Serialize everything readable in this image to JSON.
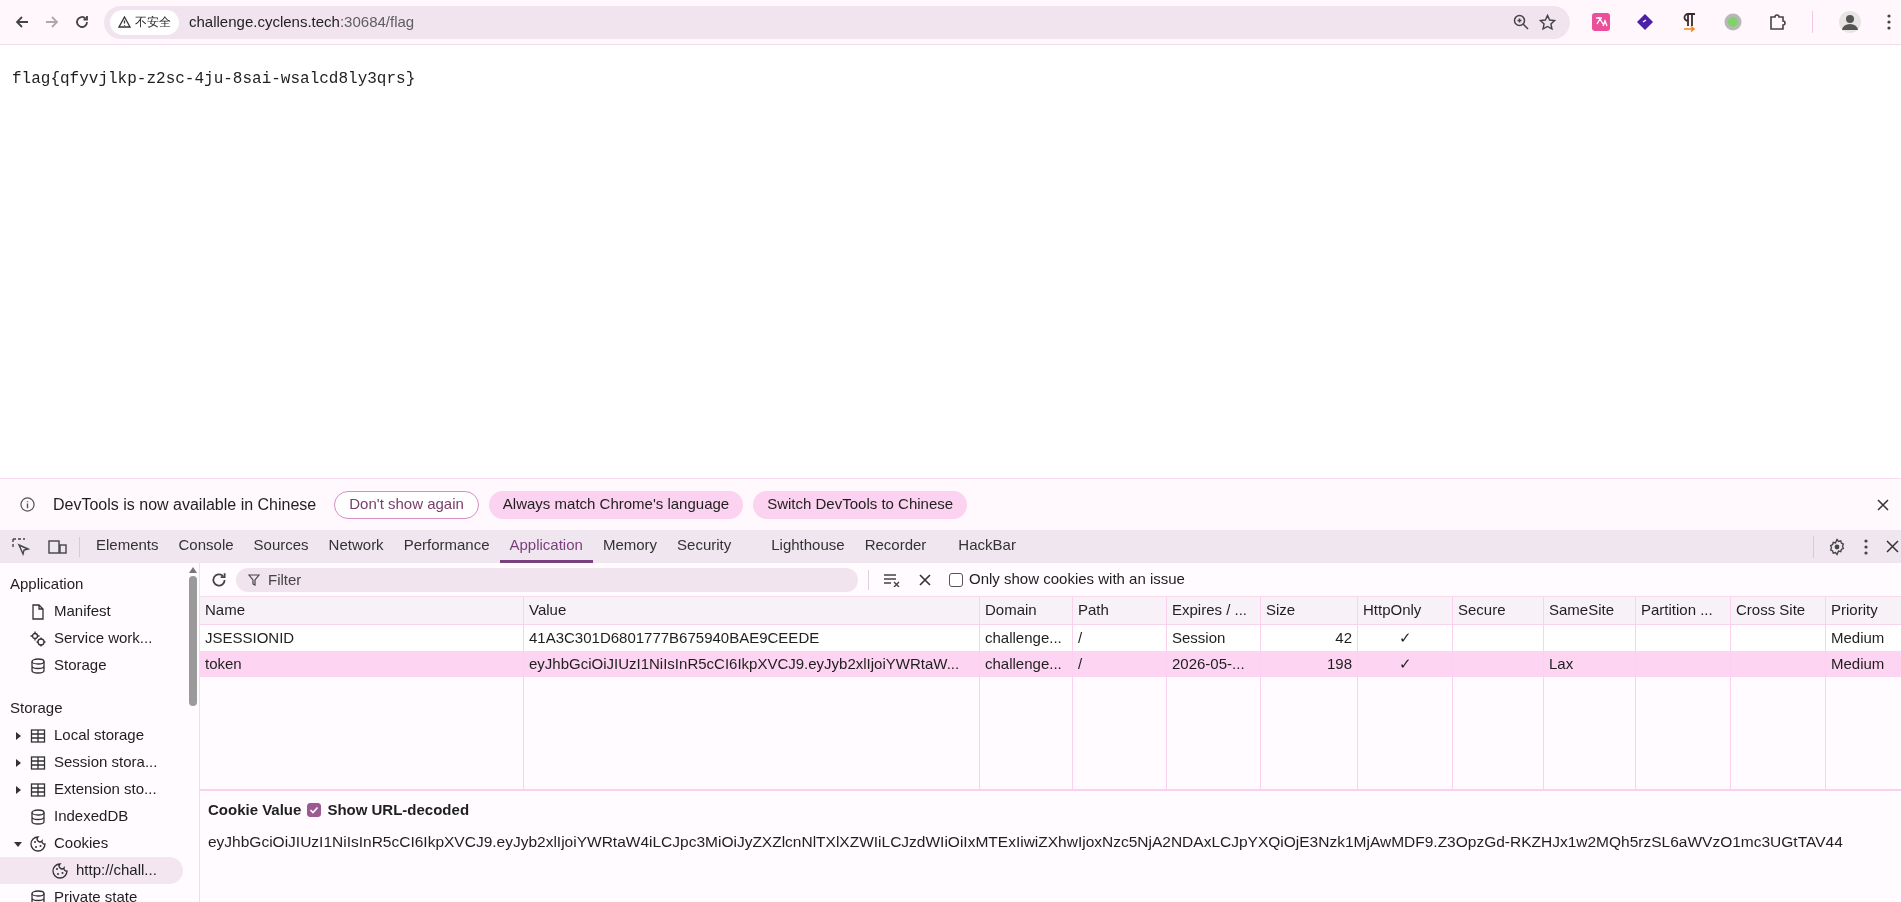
{
  "browser": {
    "address": {
      "security_label": "不安全",
      "host": "challenge.cyclens.tech",
      "port_path": ":30684/flag"
    }
  },
  "page": {
    "text": "flag{qfyvjlkp-z2sc-4ju-8sai-wsalcd8ly3qrs}"
  },
  "infobar": {
    "message": "DevTools is now available in Chinese",
    "buttons": [
      {
        "label": "Don't show again",
        "kind": "outline"
      },
      {
        "label": "Always match Chrome's language",
        "kind": "filled"
      },
      {
        "label": "Switch DevTools to Chinese",
        "kind": "filled"
      }
    ]
  },
  "devtools": {
    "tabs": [
      {
        "label": "Elements",
        "selected": false
      },
      {
        "label": "Console",
        "selected": false
      },
      {
        "label": "Sources",
        "selected": false
      },
      {
        "label": "Network",
        "selected": false
      },
      {
        "label": "Performance",
        "selected": false
      },
      {
        "label": "Application",
        "selected": true
      },
      {
        "label": "Memory",
        "selected": false
      },
      {
        "label": "Security",
        "selected": false
      },
      {
        "label": "Lighthouse",
        "selected": false
      },
      {
        "label": "Recorder",
        "selected": false
      },
      {
        "label": "HackBar",
        "selected": false
      }
    ],
    "sidebar": {
      "sections": [
        {
          "title": "Application",
          "items": [
            {
              "label": "Manifest",
              "kind": "file",
              "selected": false
            },
            {
              "label": "Service work...",
              "kind": "gears",
              "selected": false
            },
            {
              "label": "Storage",
              "kind": "database",
              "selected": false
            }
          ]
        },
        {
          "title": "Storage",
          "items": [
            {
              "label": "Local storage",
              "kind": "table",
              "expanded": false,
              "selected": false
            },
            {
              "label": "Session stora...",
              "kind": "table",
              "expanded": false,
              "selected": false
            },
            {
              "label": "Extension sto...",
              "kind": "table",
              "expanded": false,
              "selected": false
            },
            {
              "label": "IndexedDB",
              "kind": "database",
              "selected": false
            },
            {
              "label": "Cookies",
              "kind": "cookie",
              "expanded": true,
              "selected": false,
              "children": [
                {
                  "label": "http://chall...",
                  "kind": "cookie",
                  "selected": true
                }
              ]
            },
            {
              "label": "Private state",
              "kind": "database",
              "selected": false
            }
          ]
        }
      ]
    },
    "toolbar": {
      "filter_placeholder": "Filter",
      "only_issues": {
        "label": "Only show cookies with an issue",
        "checked": false
      }
    },
    "table": {
      "columns": [
        "Name",
        "Value",
        "Domain",
        "Path",
        "Expires / ...",
        "Size",
        "HttpOnly",
        "Secure",
        "SameSite",
        "Partition ...",
        "Cross Site",
        "Priority"
      ],
      "rows": [
        {
          "selected": false,
          "cells": [
            "JSESSIONID",
            "41A3C301D6801777B675940BAE9CEEDE",
            "challenge...",
            "/",
            "Session",
            "42",
            "✓",
            "",
            "",
            "",
            "",
            "Medium"
          ]
        },
        {
          "selected": true,
          "cells": [
            "token",
            "eyJhbGciOiJIUzI1NiIsInR5cCI6IkpXVCJ9.eyJyb2xlIjoiYWRtaW...",
            "challenge...",
            "/",
            "2026-05-...",
            "198",
            "✓",
            "",
            "Lax",
            "",
            "",
            "Medium"
          ]
        }
      ]
    },
    "cookie_value": {
      "title": "Cookie Value",
      "show_decoded": {
        "label": "Show URL-decoded",
        "checked": true
      },
      "value": "eyJhbGciOiJIUzI1NiIsInR5cCI6IkpXVCJ9.eyJyb2xlIjoiYWRtaW4iLCJpc3MiOiJyZXZlcnNlTXlXZWIiLCJzdWIiOiIxMTExIiwiZXhwIjoxNzc5NjA2NDAxLCJpYXQiOjE3Nzk1MjAwMDF9.Z3OpzGd-RKZHJx1w2MQh5rzSL6aWVzO1mc3UGtTAV44"
    }
  }
}
